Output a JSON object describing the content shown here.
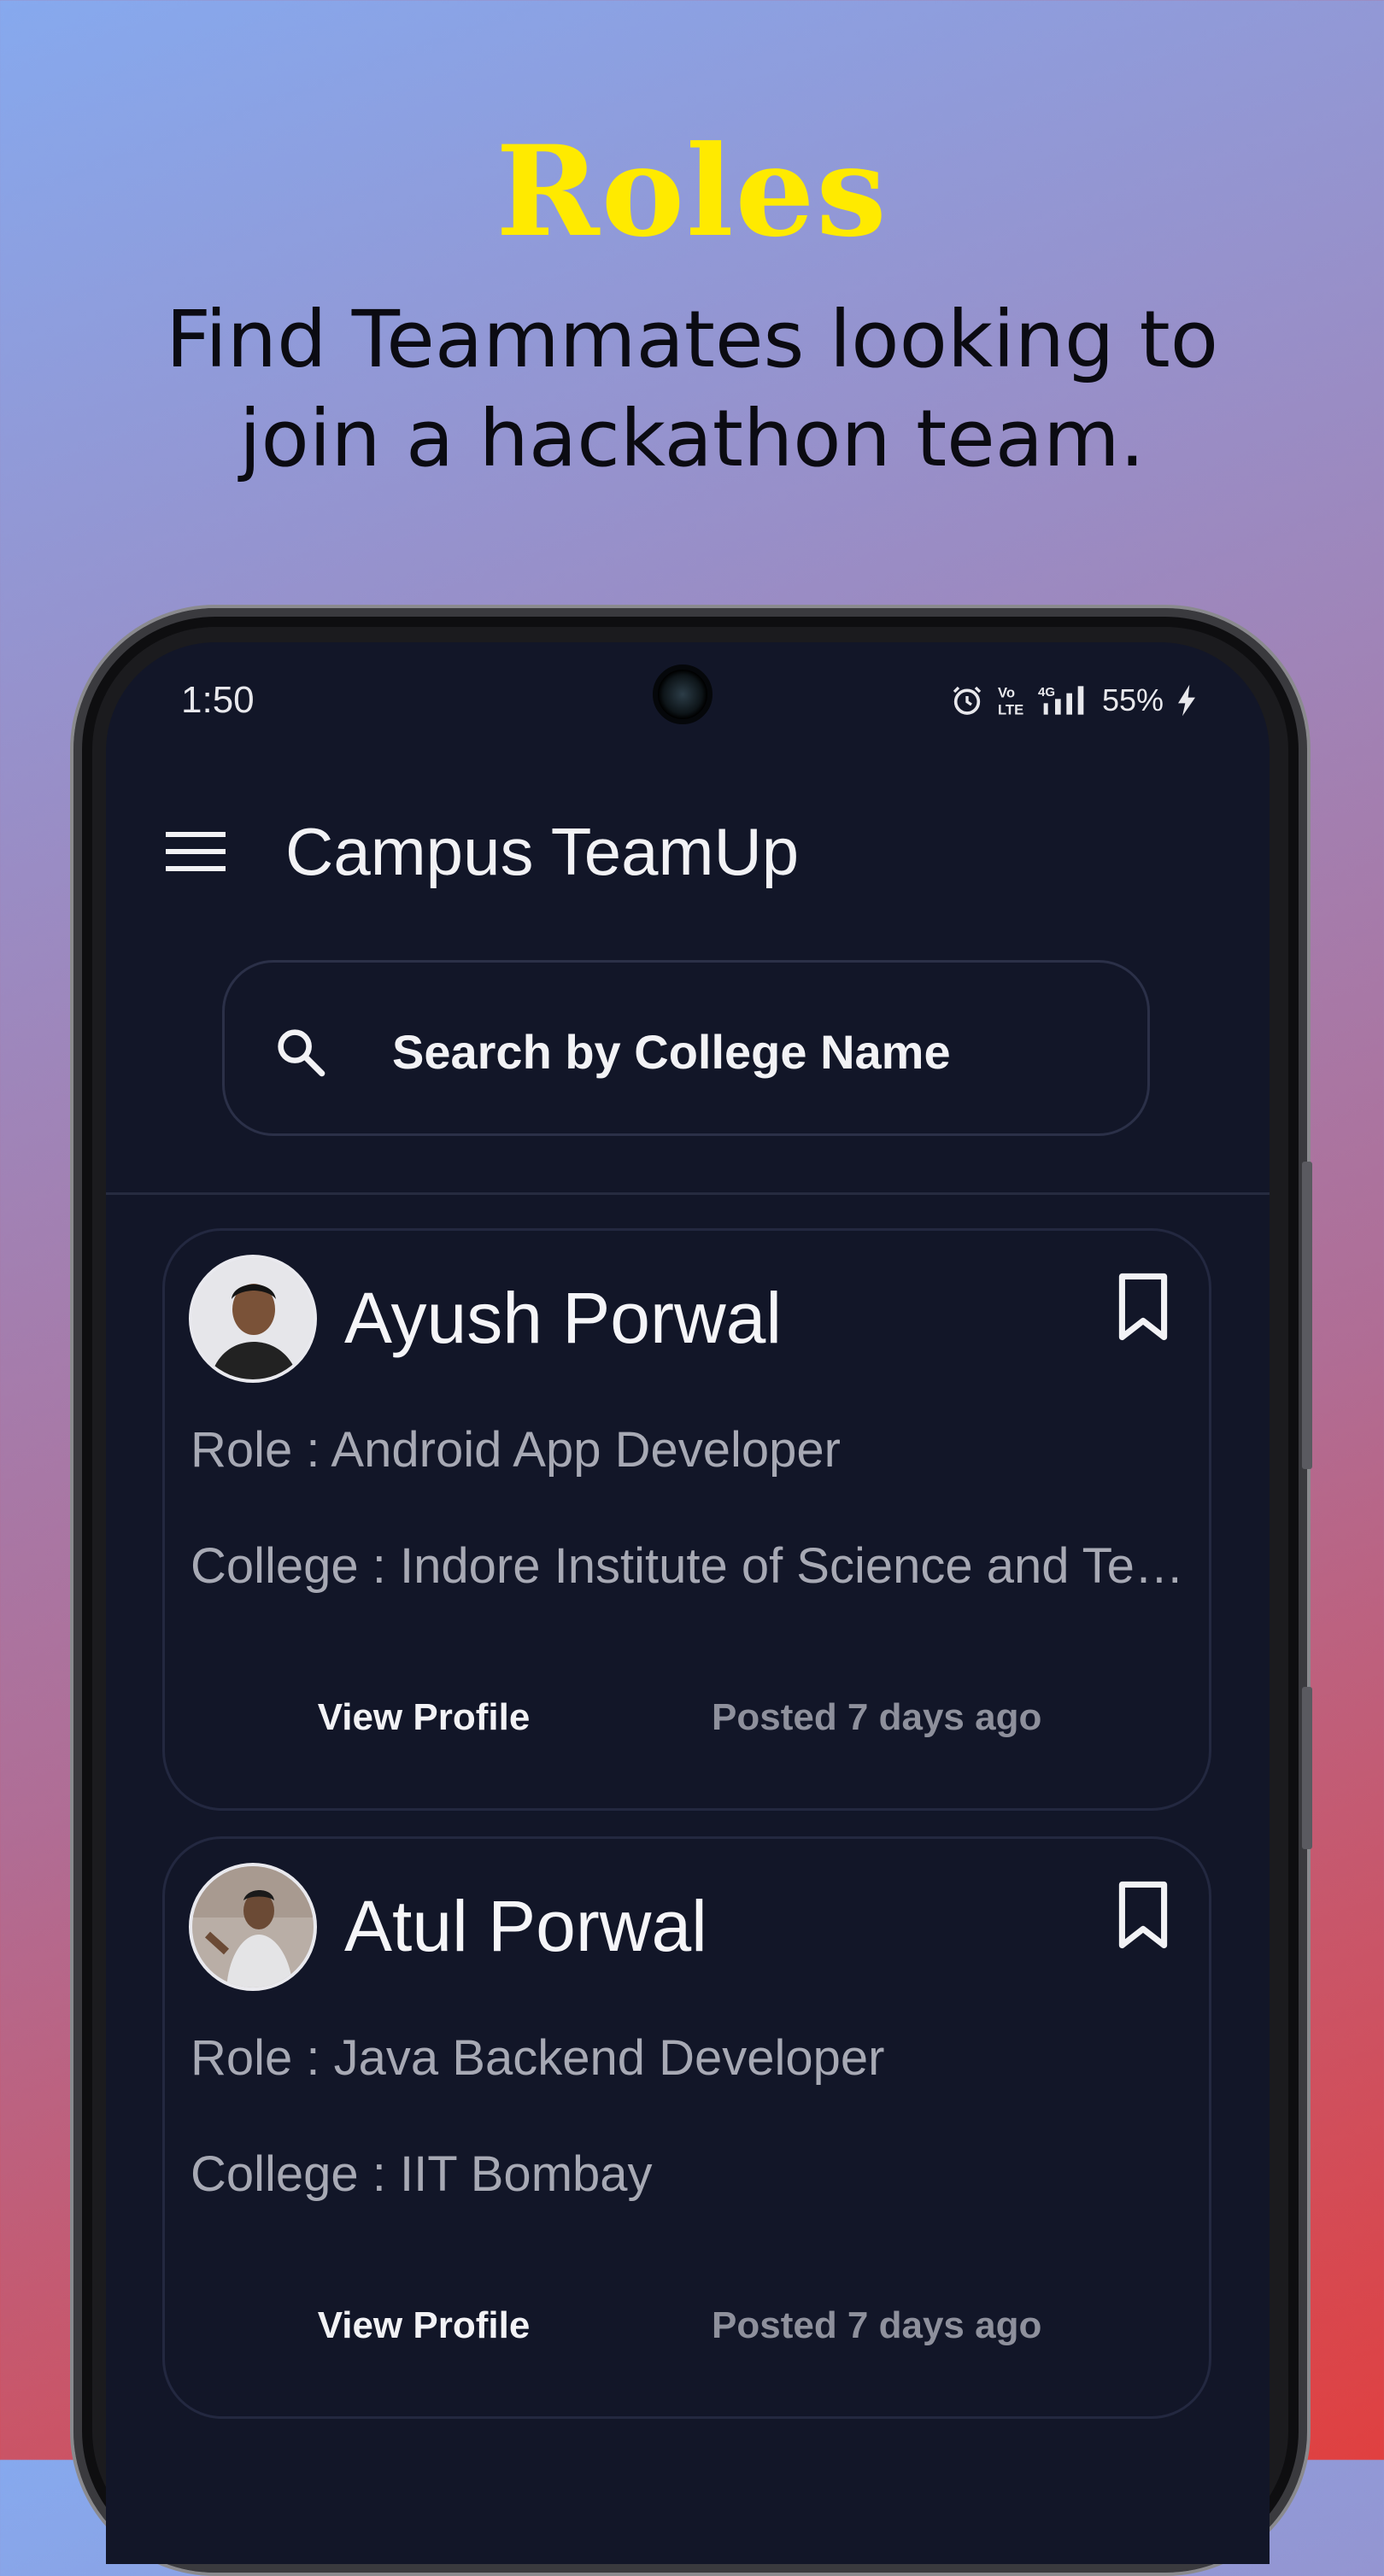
{
  "promo": {
    "title": "Roles",
    "subtitle": "Find Teammates looking to join a hackathon team."
  },
  "status_bar": {
    "time": "1:50",
    "battery": "55%"
  },
  "app_bar": {
    "title": "Campus TeamUp"
  },
  "search": {
    "placeholder": "Search by College Name"
  },
  "cards": [
    {
      "name": "Ayush Porwal",
      "role": "Role : Android App Developer",
      "college": "College : Indore Institute of Science and Technology",
      "view_label": "View Profile",
      "posted": "Posted 7 days ago"
    },
    {
      "name": "Atul Porwal",
      "role": "Role : Java Backend Developer",
      "college": "College : IIT Bombay",
      "view_label": "View Profile",
      "posted": "Posted 7 days ago"
    }
  ],
  "colors": {
    "title_yellow": "#ffea00",
    "screen_bg": "#121628",
    "card_border": "#232840",
    "secondary_text": "#a7a9b4"
  }
}
